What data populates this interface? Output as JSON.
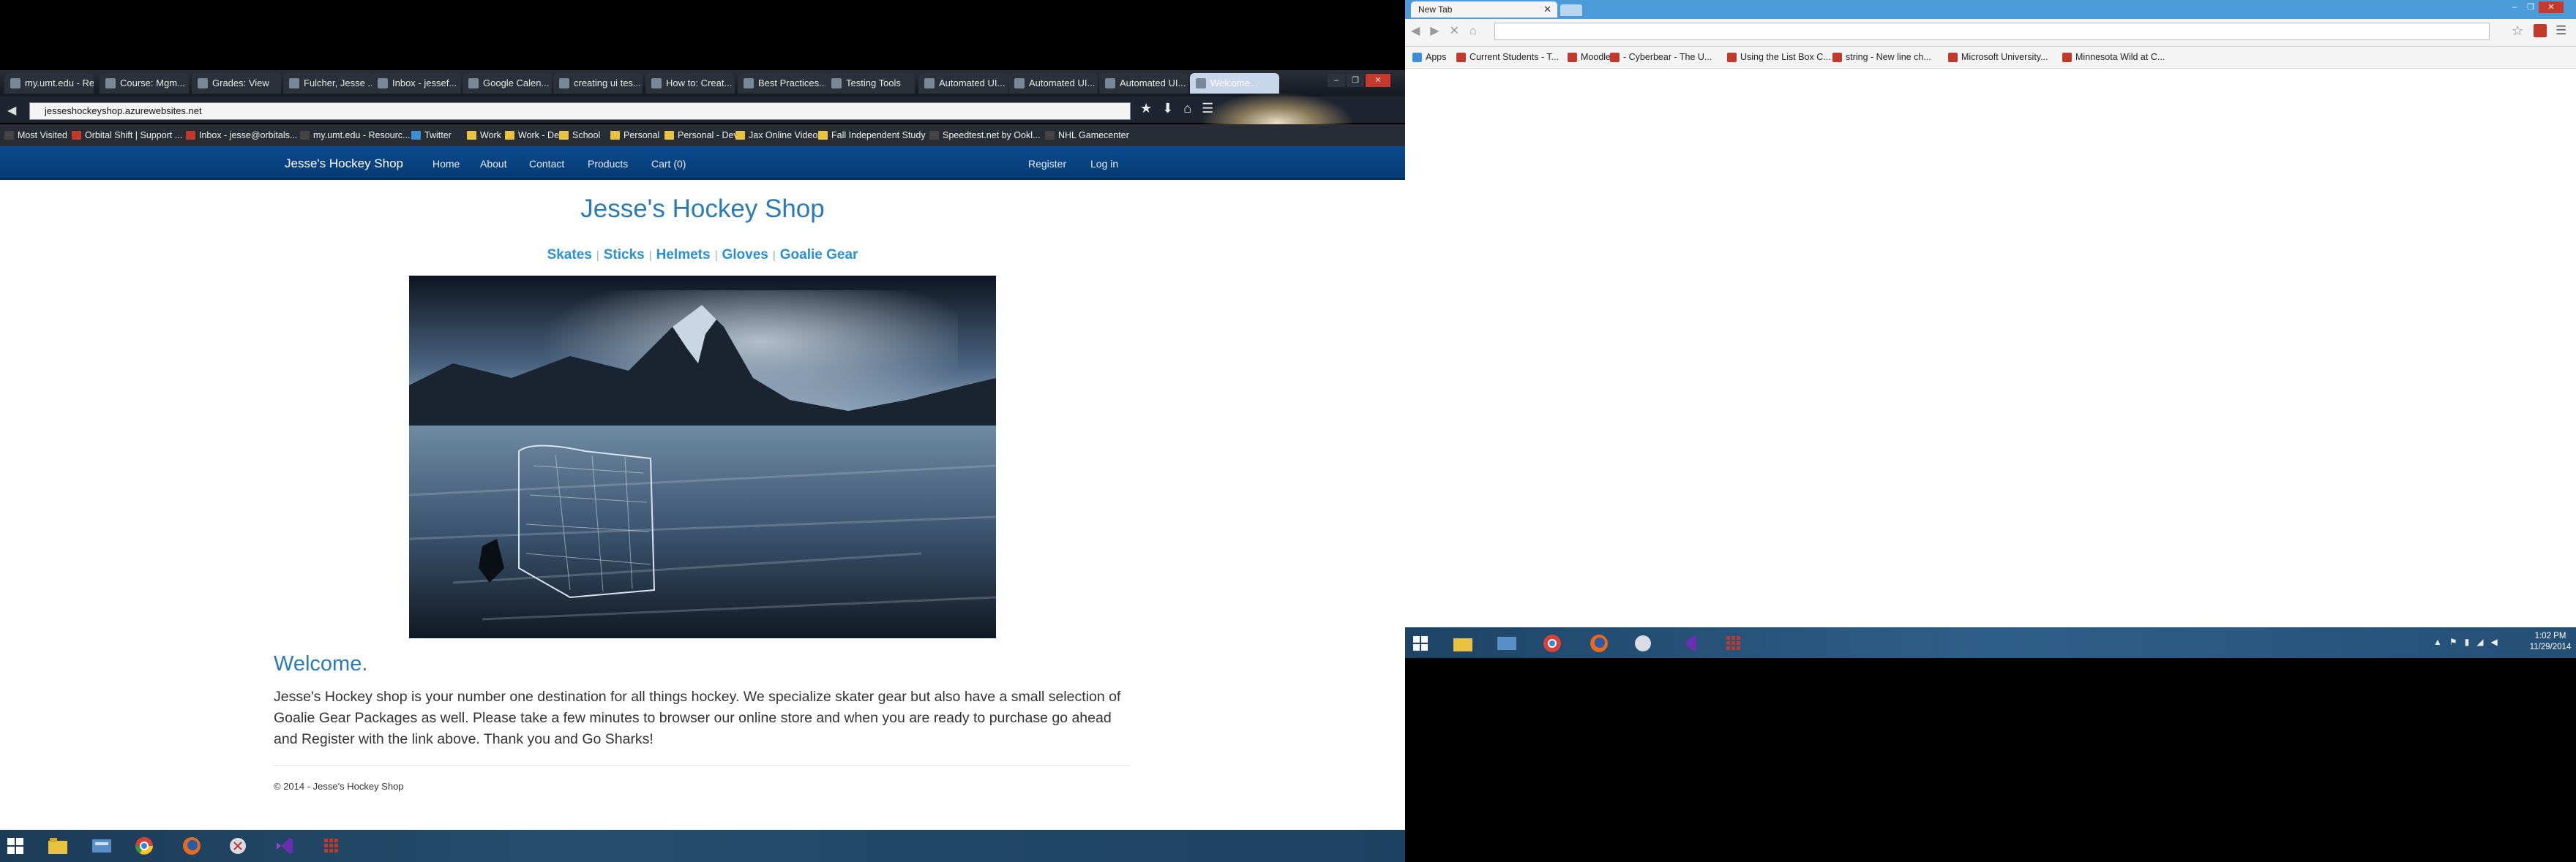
{
  "left_browser": {
    "tabs": [
      "my.umt.edu - Res...",
      "Course: Mgm...",
      "Grades: View",
      "Fulcher, Jesse ...",
      "Inbox - jessef...",
      "Google Calen...",
      "creating ui tes...",
      "How to: Creat...",
      "Best Practices...",
      "Testing Tools",
      "Automated UI...",
      "Automated UI...",
      "Automated UI...",
      "Welcome..."
    ],
    "window_buttons": {
      "minimize": "–",
      "restore": "❐",
      "close": "✕"
    },
    "url": "jesseshockeyshop.azurewebsites.net",
    "bookmarks": [
      "Most Visited",
      "Orbital Shift | Support ...",
      "Inbox - jesse@orbitals...",
      "my.umt.edu - Resourc...",
      "Twitter",
      "Work",
      "Work - Dev",
      "School",
      "Personal",
      "Personal - Dev",
      "Jax Online Videos",
      "Fall Independent Study",
      "Speedtest.net by Ookl...",
      "NHL Gamecenter"
    ]
  },
  "site": {
    "brand": "Jesse's Hockey Shop",
    "nav": {
      "home": "Home",
      "about": "About",
      "contact": "Contact",
      "products": "Products",
      "cart": "Cart (0)",
      "register": "Register",
      "login": "Log in"
    },
    "title": "Jesse's Hockey Shop",
    "categories": [
      "Skates",
      "Sticks",
      "Helmets",
      "Gloves",
      "Goalie Gear"
    ],
    "separator": "|",
    "welcome_heading": "Welcome.",
    "welcome_text": "Jesse's Hockey shop is your number one destination for all things hockey. We specialize skater gear but also have a small selection of Goalie Gear Packages as well. Please take a few minutes to browser our online store and when you are ready to purchase go ahead and Register with the link above. Thank you and Go Sharks!",
    "footer": "© 2014 - Jesse's Hockey Shop"
  },
  "right_browser": {
    "tab_title": "New Tab",
    "tab_close": "✕",
    "bookmarks": [
      "Apps",
      "Current Students - T...",
      "Moodle",
      "- Cyberbear - The U...",
      "Using the List Box C...",
      "string - New line ch...",
      "Microsoft University...",
      "Minnesota Wild at C..."
    ],
    "clock_time": "1:02 PM",
    "clock_date": "11/29/2014"
  },
  "colors": {
    "nav_blue": "#0c4a8e",
    "link_blue": "#2a8fd6",
    "heading_blue": "#2a7ab6"
  }
}
